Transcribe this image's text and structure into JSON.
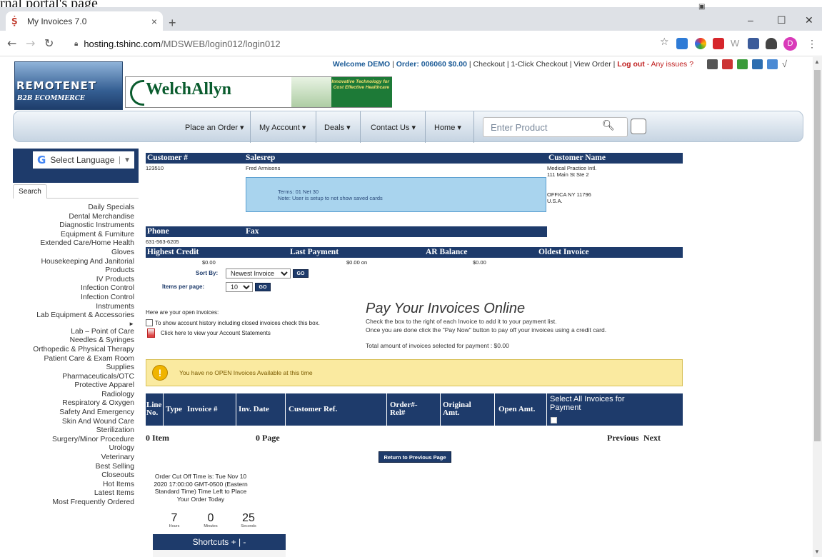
{
  "caption_text": "rnal portal's page",
  "browser": {
    "tab_title": "My Invoices 7.0",
    "tab_favicon": "Ṩ",
    "new_tab": "+",
    "url_host": "hosting.tshinc.com",
    "url_path": "/MDSWEB/login012/login012",
    "window_minimize": "–",
    "window_maximize": "☐",
    "window_close": "✕",
    "avatar_letter": "D"
  },
  "header": {
    "welcome": "Welcome DEMO",
    "order": "Order: 006060 $0.00",
    "links": [
      "Checkout",
      "1-Click Checkout",
      "View Order"
    ],
    "logout": "Log out",
    "issues": "- Any issues ?",
    "logo_main": "REMOTENET",
    "logo_sub": "B2B ECOMMERCE",
    "banner_brand": "WelchAllyn",
    "banner_tagline": "Innovative Technology for Cost Effective Healthcare"
  },
  "nav": {
    "items": [
      "Place an Order ▾",
      "My Account ▾",
      "Deals ▾",
      "Contact Us ▾",
      "Home ▾"
    ],
    "search_placeholder": "Enter Product"
  },
  "sidebar": {
    "language_label": "Select Language",
    "search_tab": "Search",
    "categories": [
      "Daily Specials",
      "Dental Merchandise",
      "Diagnostic Instruments",
      "Equipment & Furniture",
      "Extended Care/Home Health",
      "Gloves",
      "Housekeeping And Janitorial",
      "Products",
      "IV Products",
      "Infection Control",
      "Infection Control",
      "Instruments",
      "Lab Equipment & Accessories",
      "►",
      "Lab – Point of Care",
      "Needles & Syringes",
      "Orthopedic & Physical Therapy",
      "Patient Care & Exam Room",
      "Supplies",
      "Pharmaceuticals/OTC",
      "Protective Apparel",
      "Radiology",
      "Respiratory & Oxygen",
      "Safety And Emergency",
      "Skin And Wound Care",
      "Sterilization",
      "Surgery/Minor Procedure",
      "Urology",
      "Veterinary",
      "Best Selling",
      "Closeouts",
      "Hot Items",
      "Latest Items",
      "Most Frequently Ordered"
    ]
  },
  "account": {
    "customer_no_label": "Customer #",
    "customer_no": "123510",
    "salesrep_label": "Salesrep",
    "salesrep": "Fred Armisons",
    "customer_name_label": "Customer Name",
    "customer_name": "Medical Practice Intl.",
    "address1": "111 Main St Ste 2",
    "address2": "OFFICA NY 11796",
    "address3": "U.S.A.",
    "terms": "Terms: 01 Net 30",
    "note": "Note: User is setup to not show saved cards",
    "phone_label": "Phone",
    "phone": "631-563-6205",
    "fax_label": "Fax",
    "highest_credit_label": "Highest Credit",
    "highest_credit": "$0.00",
    "last_payment_label": "Last Payment",
    "last_payment": "$0.00 on",
    "ar_balance_label": "AR Balance",
    "ar_balance": "$0.00",
    "oldest_invoice_label": "Oldest Invoice"
  },
  "controls": {
    "sort_label": "Sort By:",
    "sort_value": "Newest Invoice",
    "items_label": "Items per page:",
    "items_value": "10",
    "go": "GO"
  },
  "invoices": {
    "open_text": "Here are your open invoices:",
    "history_text": "To show account history including closed invoices check this box.",
    "statements_text": "Click here to view your Account Statements",
    "pay_heading": "Pay Your Invoices Online",
    "pay_line1": "Check the box to the right of each Invoice to add it to your payment list.",
    "pay_line2": "Once you are done click the \"Pay Now\" button to pay off your invoices using a credit card.",
    "pay_total": "Total amount of invoices selected for payment : $0.00",
    "warning": "You have no OPEN Invoices Available at this time",
    "columns": [
      "Line No.",
      "Type",
      "Invoice #",
      "Inv. Date",
      "Customer Ref.",
      "Order#- Rel#",
      "Original Amt.",
      "Open Amt.",
      "Select All Invoices for Payment"
    ],
    "items_count": "0 Item",
    "page_count": "0 Page",
    "previous": "Previous",
    "next": "Next",
    "return_button": "Return to Previous Page"
  },
  "cutoff": {
    "text": "Order Cut Off Time is: Tue Nov 10 2020 17:00:00 GMT-0500 (Eastern Standard Time) Time Left to Place Your Order Today",
    "hours": "7",
    "hours_label": "Hours",
    "minutes": "0",
    "minutes_label": "Minutes",
    "seconds": "25",
    "seconds_label": "Seconds",
    "shortcuts": "Shortcuts + | -"
  }
}
